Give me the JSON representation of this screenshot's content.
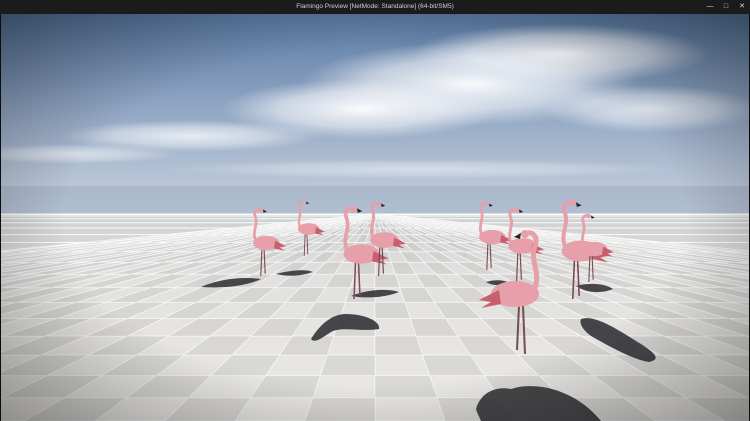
{
  "window": {
    "title": "Flamingo Preview [NetMode: Standalone]  (64-bit/SM5)",
    "controls": {
      "minimize_icon": "minimize-icon",
      "maximize_icon": "maximize-icon",
      "close_icon": "close-icon"
    }
  },
  "scene": {
    "subject": "flamingo",
    "flamingo_count": 9,
    "colors": {
      "sky_top": "#5d7ea6",
      "sky_horizon": "#c9d3e0",
      "floor_light": "#e8e6e3",
      "floor_dark": "#d4d1cd",
      "flamingo_body": "#e7a0aa",
      "flamingo_dark": "#c85f6d",
      "shadow": "#2a2a2e",
      "titlebar": "#1b1b1b"
    }
  }
}
